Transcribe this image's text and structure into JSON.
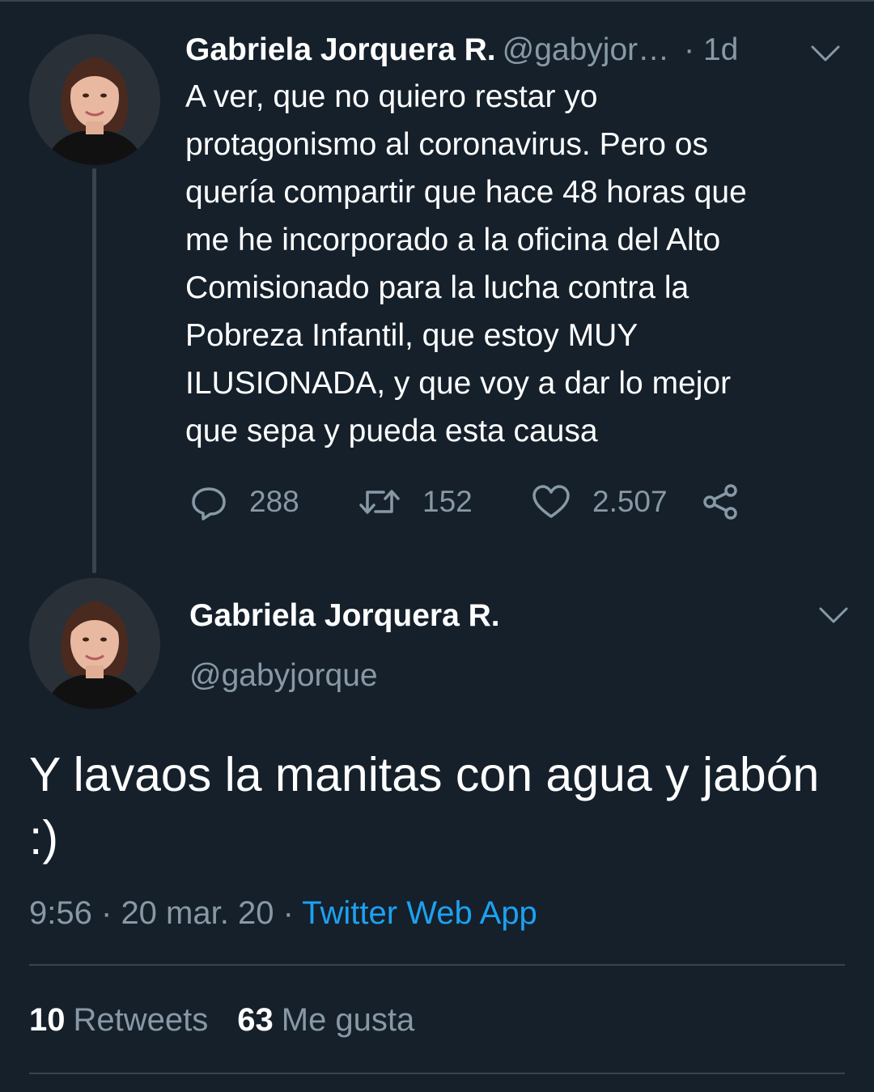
{
  "parent_tweet": {
    "author_name": "Gabriela Jorquera R.",
    "author_handle": "@gabyjor…",
    "age": "· 1d",
    "text": "A ver, que no quiero restar yo\nprotagonismo al coronavirus. Pero os\nquería compartir que hace 48 horas que\nme he incorporado a la oficina del Alto\nComisionado para la lucha contra la\nPobreza Infantil, que estoy MUY\nILUSIONADA,  y que voy a dar lo mejor\nque sepa y pueda esta causa",
    "actions": {
      "replies": "288",
      "retweets": "152",
      "likes": "2.507"
    }
  },
  "focused_tweet": {
    "author_name": "Gabriela Jorquera R.",
    "author_handle": "@gabyjorque",
    "text": "Y lavaos la manitas con agua y jabón :)",
    "time": "9:56",
    "date": "20 mar. 20",
    "separator": "·",
    "source": "Twitter Web App",
    "stats": {
      "retweets_count": "10",
      "retweets_label": "Retweets",
      "likes_count": "63",
      "likes_label": "Me gusta"
    }
  },
  "icons": [
    "avatar",
    "chevron-down-icon",
    "reply-icon",
    "retweet-icon",
    "like-icon",
    "share-icon"
  ],
  "colors": {
    "background": "#15202b",
    "text": "#ffffff",
    "muted": "#8899a6",
    "accent": "#1da1f2",
    "divider": "#38444d"
  }
}
